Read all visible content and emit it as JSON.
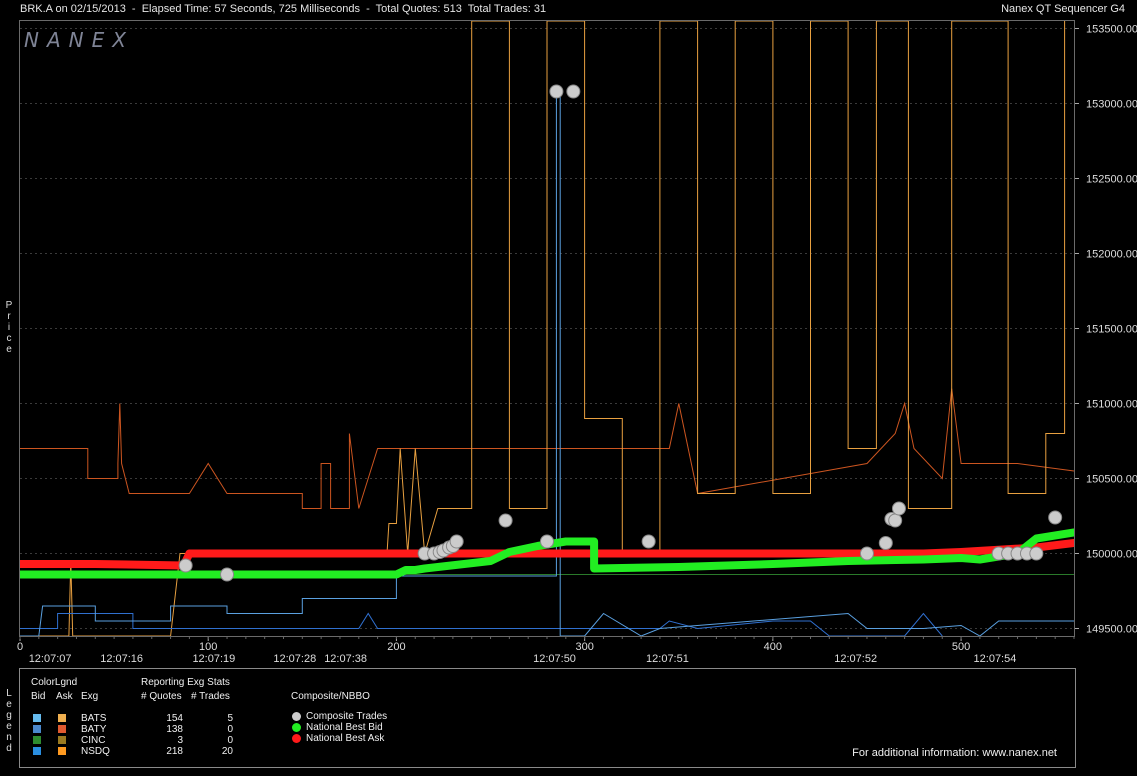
{
  "header": {
    "symbol_info": "BRK.A on 02/15/2013  -  Elapsed Time: 57 Seconds, 725 Milliseconds  -  Total Quotes: 513  Total Trades: 31",
    "app_title": "Nanex QT Sequencer G4"
  },
  "logo": "NANEX",
  "price_axis_label": "Price",
  "legend_vertical_label": "Legend",
  "chart_data": {
    "type": "line",
    "y_axis": {
      "side": "right",
      "min": 149450,
      "max": 153550,
      "ticks": [
        "153500.00",
        "153000.00",
        "152500.00",
        "152000.00",
        "151500.00",
        "151000.00",
        "150500.00",
        "150000.00",
        "149500.00"
      ]
    },
    "x_axis": {
      "min": 0,
      "max": 560,
      "ticks": [
        "0",
        "100",
        "200",
        "300",
        "400",
        "500"
      ],
      "time_labels": [
        {
          "x": 16,
          "label": "12:07:07"
        },
        {
          "x": 54,
          "label": "12:07:16"
        },
        {
          "x": 103,
          "label": "12:07:19"
        },
        {
          "x": 146,
          "label": "12:07:28"
        },
        {
          "x": 173,
          "label": "12:07:38"
        },
        {
          "x": 284,
          "label": "12:07:50"
        },
        {
          "x": 344,
          "label": "12:07:51"
        },
        {
          "x": 444,
          "label": "12:07:52"
        },
        {
          "x": 518,
          "label": "12:07:54"
        }
      ]
    },
    "reference_line": 149860,
    "series": [
      {
        "name": "National Best Ask",
        "color": "#ff1a1a",
        "points": [
          [
            0,
            149930
          ],
          [
            40,
            149930
          ],
          [
            87,
            149920
          ],
          [
            90,
            150000
          ],
          [
            300,
            150000
          ],
          [
            480,
            150000
          ],
          [
            500,
            150010
          ],
          [
            540,
            150040
          ],
          [
            560,
            150070
          ]
        ]
      },
      {
        "name": "National Best Bid",
        "color": "#22ee22",
        "points": [
          [
            0,
            149860
          ],
          [
            80,
            149860
          ],
          [
            110,
            149860
          ],
          [
            200,
            149860
          ],
          [
            205,
            149890
          ],
          [
            210,
            149890
          ],
          [
            215,
            149900
          ],
          [
            250,
            149950
          ],
          [
            260,
            150010
          ],
          [
            275,
            150050
          ],
          [
            290,
            150080
          ],
          [
            305,
            150080
          ],
          [
            305,
            149900
          ],
          [
            350,
            149910
          ],
          [
            400,
            149930
          ],
          [
            440,
            149950
          ],
          [
            480,
            149960
          ],
          [
            500,
            149970
          ],
          [
            510,
            149960
          ],
          [
            530,
            150000
          ],
          [
            540,
            150100
          ],
          [
            560,
            150140
          ]
        ]
      },
      {
        "name": "Composite Trades",
        "color": "#cccccc",
        "points": [
          [
            88,
            149920
          ],
          [
            110,
            149860
          ],
          [
            215,
            150000
          ],
          [
            220,
            150000
          ],
          [
            223,
            150010
          ],
          [
            225,
            150020
          ],
          [
            228,
            150040
          ],
          [
            230,
            150050
          ],
          [
            232,
            150080
          ],
          [
            258,
            150220
          ],
          [
            280,
            150080
          ],
          [
            285,
            153080
          ],
          [
            294,
            153080
          ],
          [
            334,
            150080
          ],
          [
            450,
            150000
          ],
          [
            460,
            150070
          ],
          [
            463,
            150230
          ],
          [
            465,
            150220
          ],
          [
            467,
            150300
          ],
          [
            520,
            150000
          ],
          [
            525,
            150000
          ],
          [
            530,
            150000
          ],
          [
            535,
            150000
          ],
          [
            540,
            150000
          ],
          [
            550,
            150240
          ]
        ]
      },
      {
        "name": "BATS Ask",
        "color": "#e8a040",
        "points": [
          [
            0,
            149450
          ],
          [
            26,
            149450
          ],
          [
            27,
            149950
          ],
          [
            28,
            149450
          ],
          [
            80,
            149450
          ],
          [
            85,
            150000
          ],
          [
            195,
            150000
          ],
          [
            196,
            150200
          ],
          [
            200,
            150200
          ],
          [
            202,
            150700
          ],
          [
            206,
            150000
          ],
          [
            210,
            150700
          ],
          [
            215,
            150000
          ],
          [
            222,
            150300
          ],
          [
            240,
            150300
          ],
          [
            240,
            153550
          ],
          [
            260,
            153550
          ],
          [
            260,
            150300
          ],
          [
            280,
            150300
          ],
          [
            280,
            153550
          ],
          [
            300,
            153550
          ],
          [
            300,
            150900
          ],
          [
            320,
            150900
          ],
          [
            320,
            150000
          ],
          [
            340,
            150000
          ],
          [
            340,
            153550
          ],
          [
            360,
            153550
          ],
          [
            360,
            150400
          ],
          [
            380,
            150400
          ],
          [
            380,
            153550
          ],
          [
            400,
            153550
          ],
          [
            400,
            150400
          ],
          [
            420,
            150400
          ],
          [
            420,
            153550
          ],
          [
            440,
            153550
          ],
          [
            440,
            150700
          ],
          [
            455,
            150700
          ],
          [
            455,
            153550
          ],
          [
            472,
            153550
          ],
          [
            472,
            150300
          ],
          [
            495,
            150300
          ],
          [
            495,
            153550
          ],
          [
            525,
            153550
          ],
          [
            525,
            150400
          ],
          [
            545,
            150400
          ],
          [
            545,
            150800
          ],
          [
            555,
            150800
          ],
          [
            555,
            153550
          ]
        ]
      },
      {
        "name": "BATY Ask",
        "color": "#cc5520",
        "points": [
          [
            0,
            150700
          ],
          [
            36,
            150700
          ],
          [
            36,
            150500
          ],
          [
            52,
            150500
          ],
          [
            52,
            150600
          ],
          [
            53,
            151000
          ],
          [
            54,
            150600
          ],
          [
            58,
            150400
          ],
          [
            90,
            150400
          ],
          [
            100,
            150600
          ],
          [
            110,
            150400
          ],
          [
            150,
            150400
          ],
          [
            150,
            150300
          ],
          [
            160,
            150300
          ],
          [
            160,
            150600
          ],
          [
            165,
            150600
          ],
          [
            165,
            150300
          ],
          [
            175,
            150300
          ],
          [
            175,
            150800
          ],
          [
            180,
            150300
          ],
          [
            190,
            150700
          ],
          [
            250,
            150700
          ],
          [
            305,
            150700
          ],
          [
            345,
            150700
          ],
          [
            350,
            151000
          ],
          [
            360,
            150400
          ],
          [
            450,
            150600
          ],
          [
            465,
            150800
          ],
          [
            470,
            151000
          ],
          [
            475,
            150700
          ],
          [
            490,
            150500
          ],
          [
            495,
            151100
          ],
          [
            500,
            150600
          ],
          [
            530,
            150600
          ],
          [
            560,
            150550
          ]
        ]
      },
      {
        "name": "BATS Bid",
        "color": "#5aa0e0",
        "points": [
          [
            0,
            149450
          ],
          [
            10,
            149450
          ],
          [
            12,
            149650
          ],
          [
            40,
            149650
          ],
          [
            40,
            149550
          ],
          [
            80,
            149550
          ],
          [
            80,
            149650
          ],
          [
            110,
            149650
          ],
          [
            110,
            149600
          ],
          [
            150,
            149600
          ],
          [
            150,
            149700
          ],
          [
            200,
            149700
          ],
          [
            200,
            149850
          ],
          [
            285,
            149850
          ],
          [
            285,
            153080
          ],
          [
            287,
            153080
          ],
          [
            287,
            149450
          ],
          [
            300,
            149450
          ],
          [
            310,
            149600
          ],
          [
            330,
            149450
          ],
          [
            340,
            149500
          ],
          [
            440,
            149600
          ],
          [
            450,
            149500
          ],
          [
            480,
            149500
          ],
          [
            500,
            149520
          ],
          [
            510,
            149450
          ],
          [
            520,
            149550
          ],
          [
            560,
            149550
          ]
        ]
      },
      {
        "name": "NSDQ Bid",
        "color": "#3070d0",
        "points": [
          [
            0,
            149500
          ],
          [
            20,
            149500
          ],
          [
            20,
            149600
          ],
          [
            60,
            149600
          ],
          [
            60,
            149500
          ],
          [
            180,
            149500
          ],
          [
            185,
            149600
          ],
          [
            190,
            149500
          ],
          [
            340,
            149500
          ],
          [
            345,
            149550
          ],
          [
            360,
            149500
          ],
          [
            400,
            149550
          ],
          [
            420,
            149550
          ],
          [
            430,
            149450
          ],
          [
            470,
            149450
          ],
          [
            480,
            149600
          ],
          [
            490,
            149450
          ]
        ]
      }
    ]
  },
  "legend": {
    "color_legend_title": "ColorLgnd",
    "bid_header": "Bid",
    "ask_header": "Ask",
    "exg_header": "Exg",
    "stats_title": "Reporting Exg Stats",
    "quotes_header": "# Quotes",
    "trades_header": "# Trades",
    "composite_title": "Composite/NBBO",
    "exchanges": [
      {
        "name": "BATS",
        "quotes": "154",
        "trades": "5",
        "bid_color": "#66bbee",
        "ask_color": "#f0b050"
      },
      {
        "name": "BATY",
        "quotes": "138",
        "trades": "0",
        "bid_color": "#4a88cc",
        "ask_color": "#e05a30"
      },
      {
        "name": "CINC",
        "quotes": "3",
        "trades": "0",
        "bid_color": "#2e8b2e",
        "ask_color": "#9a7a20"
      },
      {
        "name": "NSDQ",
        "quotes": "218",
        "trades": "20",
        "bid_color": "#2a8ee0",
        "ask_color": "#ff9a20"
      }
    ],
    "composite_items": [
      {
        "label": "Composite Trades",
        "color": "#cccccc"
      },
      {
        "label": "National Best Bid",
        "color": "#22ee22"
      },
      {
        "label": "National Best Ask",
        "color": "#ff1a1a"
      }
    ],
    "footer": "For additional information: www.nanex.net"
  }
}
